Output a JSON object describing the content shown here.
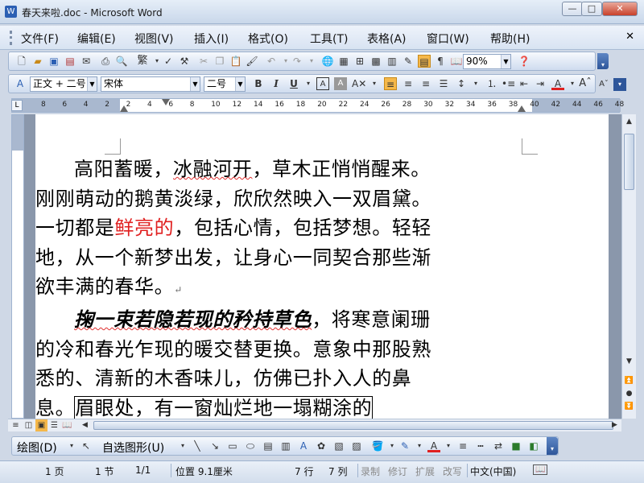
{
  "window": {
    "title": "春天来啦.doc - Microsoft Word",
    "app_icon": "W"
  },
  "window_controls": {
    "minimize": "—",
    "maximize": "□",
    "close": "✕"
  },
  "menu": [
    "文件(F)",
    "编辑(E)",
    "视图(V)",
    "插入(I)",
    "格式(O)",
    "工具(T)",
    "表格(A)",
    "窗口(W)",
    "帮助(H)"
  ],
  "standard_toolbar": {
    "traditional_chinese": "繁",
    "zoom": "90%"
  },
  "format_toolbar": {
    "style": "正文 + 二号",
    "font": "宋体",
    "size": "二号",
    "bold": "B",
    "italic": "I",
    "underline": "U",
    "font_color": "#e02020",
    "highlight_color": "#ffd400"
  },
  "ruler": {
    "numbers": [
      "8",
      "6",
      "4",
      "2",
      "2",
      "4",
      "6",
      "8",
      "10",
      "12",
      "14",
      "16",
      "18",
      "20",
      "22",
      "24",
      "26",
      "28",
      "30",
      "32",
      "34",
      "36",
      "38",
      "40",
      "42",
      "44",
      "46",
      "48"
    ]
  },
  "document": {
    "p1": {
      "before_squiggle": "高阳蓄暖，",
      "squiggle": "冰融河开",
      "mid": "，草木正悄悄醒来。刚刚萌动的鹅黄淡绿，欣欣然映入一双眉黛。一切都是",
      "red": "鲜亮的",
      "after": "，包括心情，包括梦想。轻轻地，从一个新梦出发，让身心一同契合那些渐欲丰满的春华。"
    },
    "p2": {
      "bold_italic": "掬一束若隐若现的矜持草色",
      "mid": "，将寒意阑珊的冷和春光乍现的暖交替更换。意象中那股熟悉的、清新的木香味儿，仿佛已扑入人的鼻息。",
      "boxed": "眉眼处，有一窗灿烂地一塌糊涂的"
    },
    "paragraph_mark": "↵"
  },
  "draw_toolbar": {
    "draw": "绘图(D)",
    "autoshapes": "自选图形(U)"
  },
  "status": {
    "page": "1 页",
    "section": "1 节",
    "page_count": "1/1",
    "position": "位置 9.1厘米",
    "line": "7 行",
    "column": "7 列",
    "rec": "录制",
    "trk": "修订",
    "ext": "扩展",
    "ovr": "改写",
    "language": "中文(中国)"
  }
}
